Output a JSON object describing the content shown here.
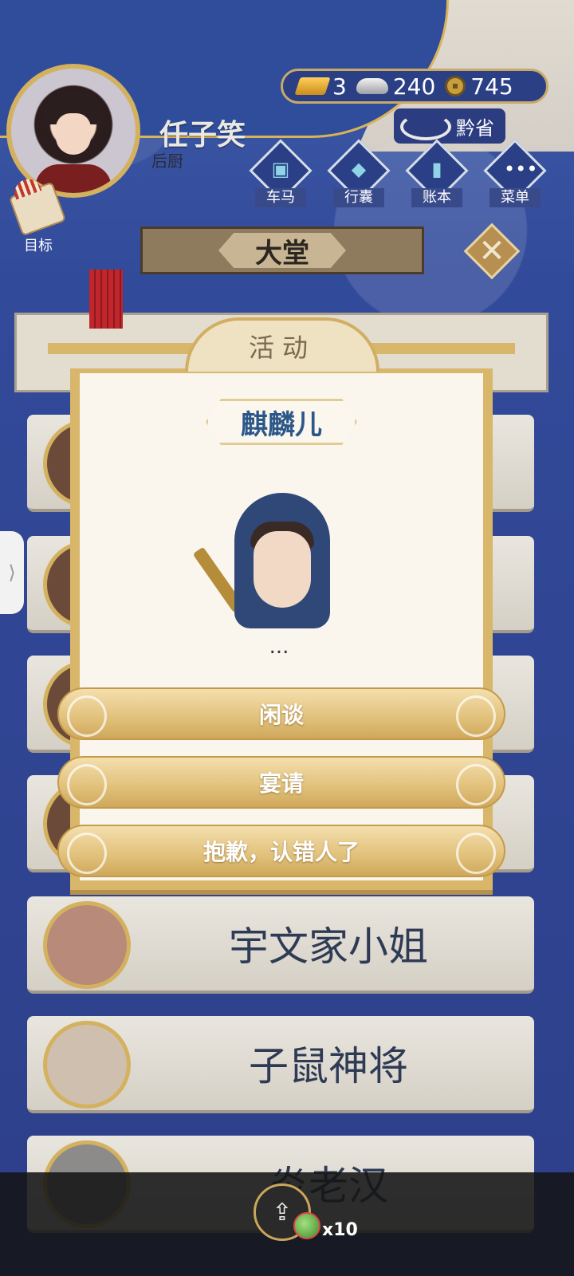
{
  "player": {
    "name": "任子笑",
    "role": "后厨"
  },
  "currency": {
    "gold": "3",
    "silver": "240",
    "coins": "745"
  },
  "region": "黔省",
  "menu": [
    {
      "label": "车马",
      "icon": "carriage-icon"
    },
    {
      "label": "行囊",
      "icon": "bag-icon"
    },
    {
      "label": "账本",
      "icon": "ledger-icon"
    },
    {
      "label": "菜单",
      "icon": "more-icon"
    }
  ],
  "goal_label": "目标",
  "hall_title": "大堂",
  "modal": {
    "header": "活动",
    "npc_name": "麒麟儿",
    "npc_text": "...",
    "options": [
      "闲谈",
      "宴请",
      "抱歉，认错人了"
    ]
  },
  "visitors": [
    {
      "name": "宇文家小姐"
    },
    {
      "name": "子鼠神将"
    },
    {
      "name": "炎老汉"
    }
  ],
  "share": {
    "count": "x10"
  },
  "colors": {
    "gold_accent": "#d8b66a",
    "npc_name": "#2c5789",
    "background": "#2e3f86"
  }
}
